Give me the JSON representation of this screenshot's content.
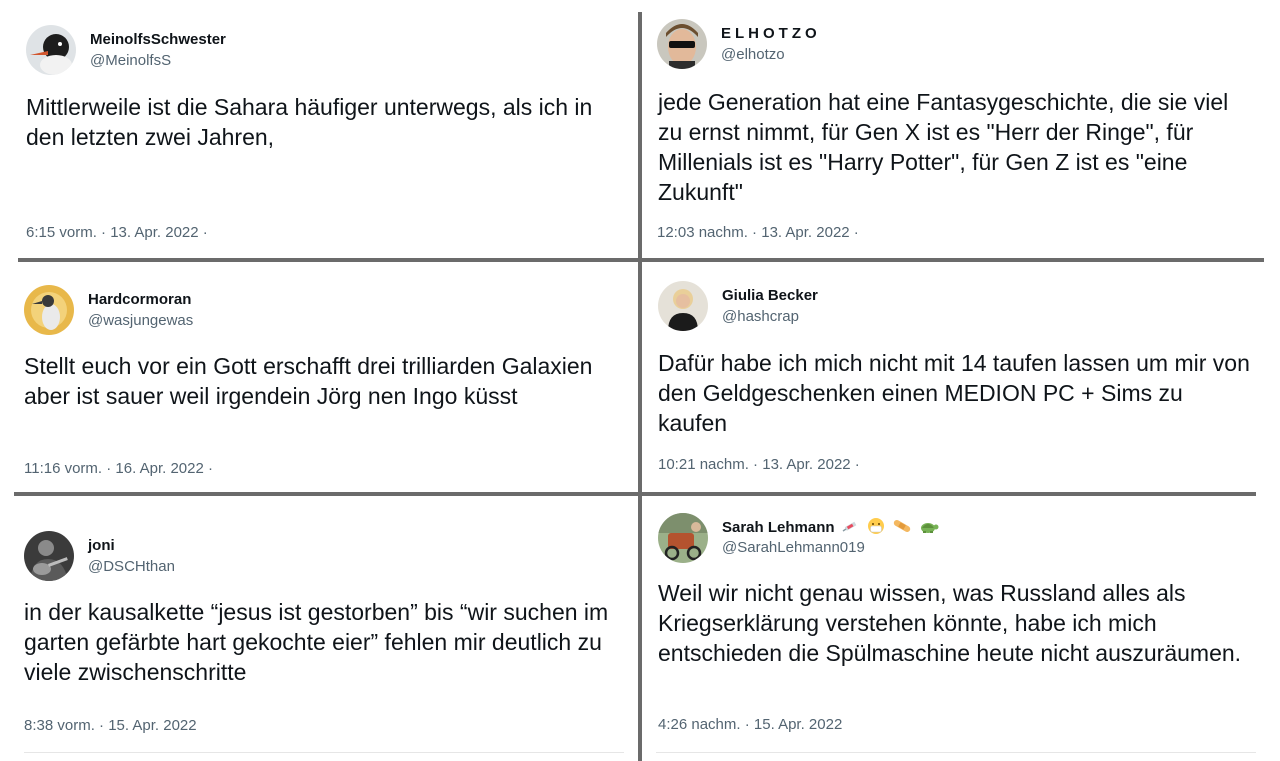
{
  "tweets": [
    {
      "id": "t1",
      "name": "MeinolfsSchwester",
      "handle": "@MeinolfsS",
      "text": "Mittlerweile ist die Sahara häufiger unterwegs, als ich in den letzten zwei Jahren,",
      "time": "6:15 vorm. · 13. Apr. 2022 ·",
      "avatar_icon": "bird-avatar"
    },
    {
      "id": "t2",
      "name": "ELHOTZO",
      "handle": "@elhotzo",
      "text": "jede Generation hat eine Fantasygeschichte, die sie viel zu ernst nimmt, für Gen X ist es \"Herr der Ringe\", für Millenials ist es \"Harry Potter\", für Gen Z ist es \"eine Zukunft\"",
      "time": "12:03 nachm. · 13. Apr. 2022 ·",
      "avatar_icon": "sunglasses-avatar"
    },
    {
      "id": "t3",
      "name": "Hardcormoran",
      "handle": "@wasjungewas",
      "text": "Stellt euch vor ein Gott erschafft drei trilliarden Galaxien aber ist sauer weil irgendein Jörg nen Ingo küsst",
      "time": "11:16 vorm. · 16. Apr. 2022 ·",
      "avatar_icon": "cormorant-avatar"
    },
    {
      "id": "t4",
      "name": "Giulia Becker",
      "handle": "@hashcrap",
      "text": "Dafür habe ich mich nicht mit 14 taufen lassen um mir von den Geldgeschenken einen MEDION PC + Sims zu kaufen",
      "time": "10:21 nachm. · 13. Apr. 2022 ·",
      "avatar_icon": "person-avatar"
    },
    {
      "id": "t5",
      "name": "joni",
      "handle": "@DSCHthan",
      "text": "in der kausalkette “jesus ist gestorben” bis “wir suchen im garten gefärbte hart gekochte eier” fehlen mir deutlich zu viele zwischenschritte",
      "time": "8:38 vorm. · 15. Apr. 2022",
      "avatar_icon": "guitar-avatar"
    },
    {
      "id": "t6",
      "name": "Sarah Lehmann",
      "handle": "@SarahLehmann019",
      "name_emojis": [
        "syringe-icon",
        "mask-face-icon",
        "bandage-icon",
        "turtle-icon"
      ],
      "text": "Weil wir nicht genau wissen, was Russland alles als Kriegserklärung verstehen könnte, habe ich mich entschieden die Spülmaschine heute nicht auszuräumen.",
      "time": "4:26 nachm. · 15. Apr. 2022",
      "avatar_icon": "bike-avatar"
    }
  ],
  "colors": {
    "divider": "#6b6b6b",
    "secondary_text": "#536471",
    "primary_text": "#0f1419"
  }
}
